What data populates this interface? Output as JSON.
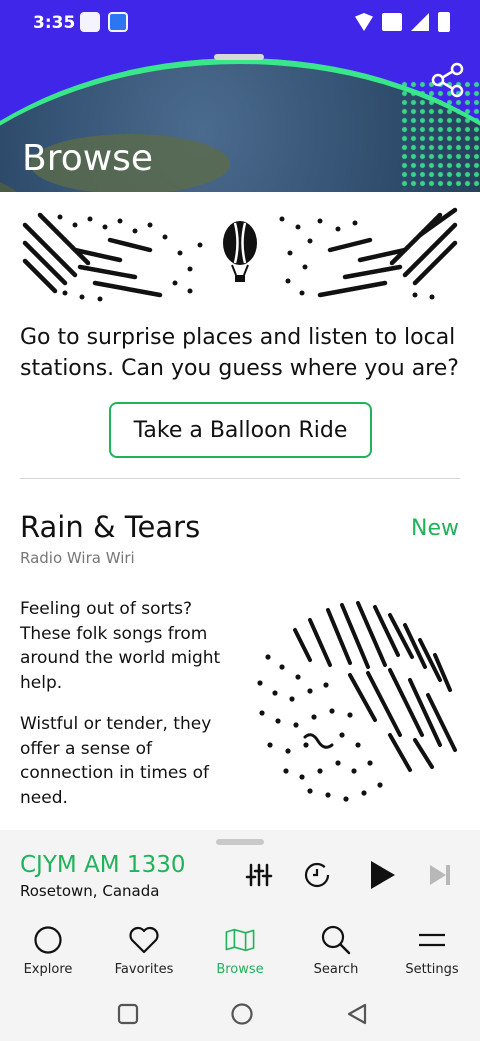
{
  "status": {
    "time": "3:35"
  },
  "header": {
    "title": "Browse"
  },
  "balloon": {
    "description": "Go to surprise places and listen to local stations. Can you guess where you are?",
    "button_label": "Take a Balloon Ride"
  },
  "feature": {
    "title": "Rain & Tears",
    "badge": "New",
    "subtitle": "Radio Wira Wiri",
    "paragraph1": "Feeling out of sorts? These folk songs from around the world might help.",
    "paragraph2": "Wistful or tender, they offer a sense of connection in times of need."
  },
  "player": {
    "station": "CJYM AM 1330",
    "location": "Rosetown, Canada"
  },
  "nav": {
    "items": [
      {
        "label": "Explore",
        "icon": "circle-icon"
      },
      {
        "label": "Favorites",
        "icon": "heart-icon"
      },
      {
        "label": "Browse",
        "icon": "map-icon"
      },
      {
        "label": "Search",
        "icon": "search-icon"
      },
      {
        "label": "Settings",
        "icon": "menu-icon"
      }
    ],
    "active": "Browse"
  },
  "colors": {
    "accent": "#20b35a",
    "header_bg": "#3f26e8"
  }
}
